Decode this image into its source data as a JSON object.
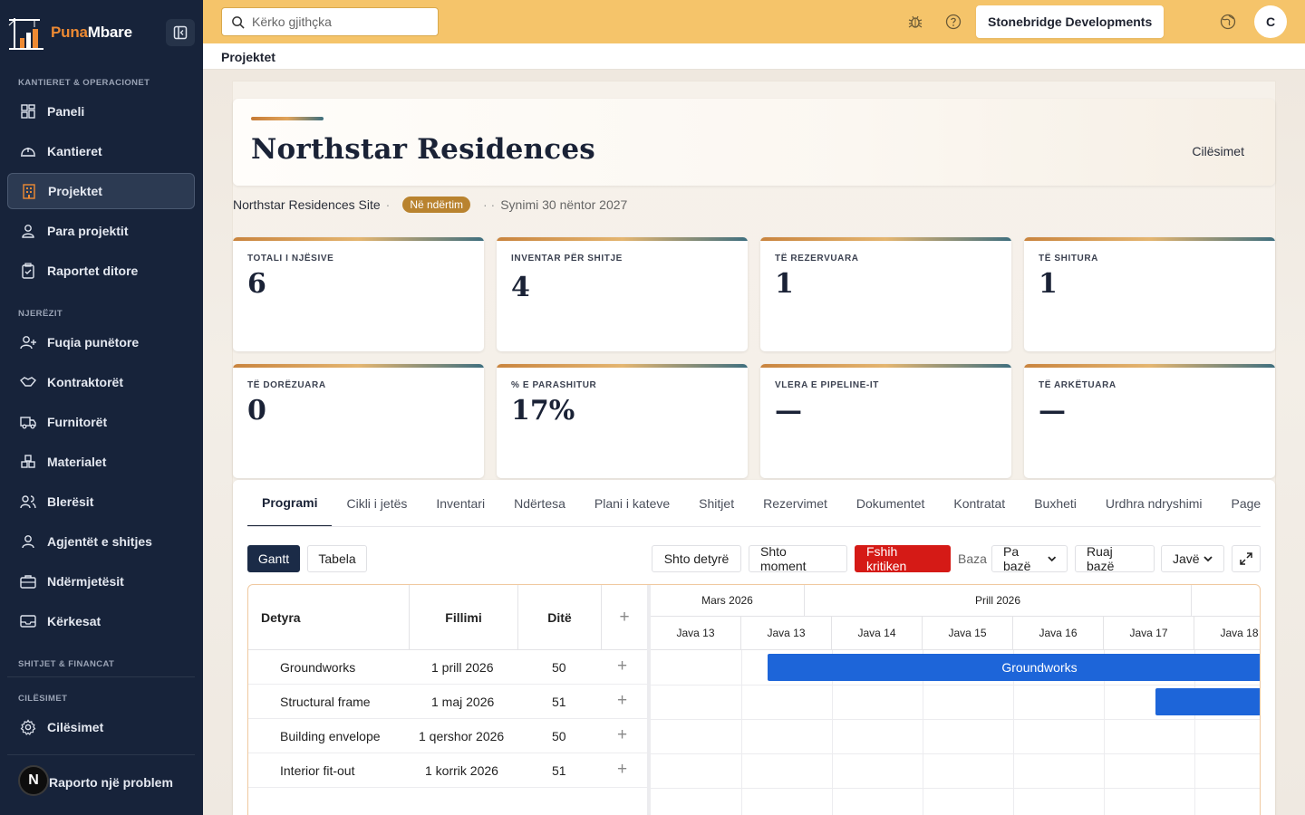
{
  "app": {
    "logo_part1": "Puna",
    "logo_part2": "Mbare"
  },
  "sidebar": {
    "sections": {
      "sites": "KANTIERET & OPERACIONET",
      "people": "NJERËZIT",
      "sales": "SHITJET & FINANCAT",
      "settings": "CILËSIMET"
    },
    "items": {
      "dashboard": "Paneli",
      "sites": "Kantieret",
      "projects": "Projektet",
      "project_money": "Para projektit",
      "daily_reports": "Raportet ditore",
      "workforce": "Fuqia punëtore",
      "contractors": "Kontraktorët",
      "suppliers": "Furnitorët",
      "materials": "Materialet",
      "buyers": "Blerësit",
      "sales_agents": "Agjentët e shitjes",
      "companies": "Ndërmjetësit",
      "requests": "Kërkesat",
      "settings": "Cilësimet"
    },
    "report_avatar": "N",
    "report_problem": "Raporto një problem"
  },
  "topbar": {
    "search_placeholder": "Kërko gjithçka",
    "organization": "Stonebridge Developments",
    "user_initial": "C"
  },
  "breadcrumb": "Projektet",
  "project": {
    "title": "Northstar Residences",
    "settings_link": "Cilësimet",
    "site": "Northstar Residences Site",
    "status": "Në ndërtim",
    "separator": "·",
    "separator2": "· ·",
    "sync": "Synimi 30 nëntor 2027"
  },
  "stats": [
    {
      "label": "TOTALI I NJËSIVE",
      "value": "6"
    },
    {
      "label": "INVENTAR PËR SHITJE",
      "value": "4"
    },
    {
      "label": "TË REZERVUARA",
      "value": "1"
    },
    {
      "label": "TË SHITURA",
      "value": "1"
    },
    {
      "label": "TË DORËZUARA",
      "value": "0"
    },
    {
      "label": "% E PARASHITUR",
      "value": "17%"
    },
    {
      "label": "VLERA E PIPELINE-IT",
      "value": "—"
    },
    {
      "label": "TË ARKËTUARA",
      "value": "—"
    }
  ],
  "tabs": [
    "Programi",
    "Cikli i jetës",
    "Inventari",
    "Ndërtesa",
    "Plani i kateve",
    "Shitjet",
    "Rezervimet",
    "Dokumentet",
    "Kontratat",
    "Buxheti",
    "Urdhra ndryshimi",
    "Pagesat"
  ],
  "toolbar": {
    "gantt": "Gantt",
    "table": "Tabela",
    "add_task": "Shto detyrë",
    "add_milestone": "Shto moment",
    "hide_critical": "Fshih kritiken",
    "baseline_label": "Baza",
    "baseline_select": "Pa bazë",
    "save_baseline": "Ruaj bazë",
    "scale_select": "Javë"
  },
  "gantt": {
    "headers": {
      "task": "Detyra",
      "start": "Fillimi",
      "days": "Ditë",
      "add": "+"
    },
    "rows": [
      {
        "task": "Groundworks",
        "start": "1 prill 2026",
        "days": "50",
        "add": "+"
      },
      {
        "task": "Structural frame",
        "start": "1 maj 2026",
        "days": "51",
        "add": "+"
      },
      {
        "task": "Building envelope",
        "start": "1 qershor 2026",
        "days": "50",
        "add": "+"
      },
      {
        "task": "Interior fit-out",
        "start": "1 korrik 2026",
        "days": "51",
        "add": "+"
      }
    ],
    "months": [
      "Mars 2026",
      "Prill 2026"
    ],
    "weeks": [
      "Java 13",
      "Java 13",
      "Java 14",
      "Java 15",
      "Java 16",
      "Java 17",
      "Java 18"
    ],
    "bars": [
      {
        "label": "Groundworks"
      },
      {
        "label": ""
      }
    ],
    "bar_color": "#1d65d9"
  },
  "colors": {
    "sidebar": "#17233a",
    "topbar": "#f5c46a",
    "accent": "#ee8a33",
    "danger": "#d51a16",
    "status": "#b9832f"
  }
}
